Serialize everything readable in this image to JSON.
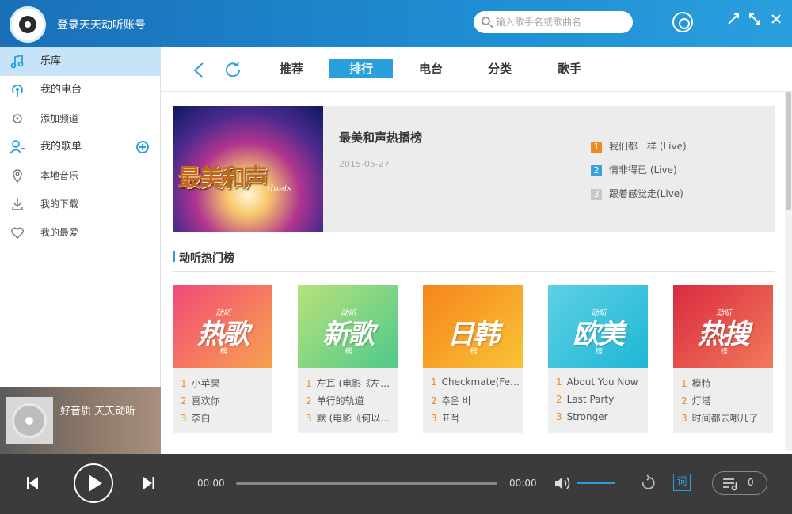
{
  "header": {
    "login_text": "登录天天动听账号",
    "search_placeholder": "输入歌手名或歌曲名"
  },
  "sidebar": {
    "items": [
      {
        "label": "乐库",
        "icon": "music-note-icon",
        "active": true
      },
      {
        "label": "我的电台",
        "icon": "radio-icon"
      },
      {
        "label": "添加频道",
        "icon": "target-icon",
        "sub": true
      },
      {
        "label": "我的歌单",
        "icon": "user-icon"
      },
      {
        "label": "本地音乐",
        "icon": "location-icon",
        "sub": true
      },
      {
        "label": "我的下载",
        "icon": "download-icon",
        "sub": true
      },
      {
        "label": "我的最爱",
        "icon": "heart-icon",
        "sub": true
      }
    ]
  },
  "mini_player": {
    "text": "好音质 天天动听"
  },
  "tabs": [
    "推荐",
    "排行",
    "电台",
    "分类",
    "歌手"
  ],
  "active_tab": "排行",
  "banner": {
    "art_text": "最美和声",
    "art_sub": "duets",
    "title": "最美和声热播榜",
    "date": "2015-05-27",
    "tracks": [
      {
        "num": "1",
        "name": "我们都一样 (Live)"
      },
      {
        "num": "2",
        "name": "情非得已 (Live)"
      },
      {
        "num": "3",
        "name": "跟着感觉走(Live)"
      }
    ]
  },
  "section": {
    "title": "动听热门榜"
  },
  "charts": [
    {
      "brand": "动听",
      "art_text": "热歌",
      "sub": "榜",
      "gradient": [
        "#f24a7a",
        "#f7a34b"
      ],
      "songs": [
        "小苹果",
        "喜欢你",
        "李白"
      ]
    },
    {
      "brand": "动听",
      "art_text": "新歌",
      "sub": "榜",
      "gradient": [
        "#4fc98a",
        "#b7e27a"
      ],
      "songs": [
        "左耳 (电影《左耳》主题曲)",
        "单行的轨道",
        "默 (电影《何以笙箫默》主题曲)"
      ]
    },
    {
      "brand": "",
      "art_text": "日韩",
      "sub": "榜",
      "gradient": [
        "#f5851c",
        "#f9c336"
      ],
      "songs": [
        "Checkmate(Feat. Yoo Seung Woo)",
        "추운 비",
        "표적"
      ]
    },
    {
      "brand": "动听",
      "art_text": "欧美",
      "sub": "榜",
      "gradient": [
        "#1db7d6",
        "#5fd0e4"
      ],
      "songs": [
        "About You Now",
        "Last Party",
        "Stronger"
      ]
    },
    {
      "brand": "动听",
      "art_text": "热搜",
      "sub": "榜",
      "gradient": [
        "#d92a3f",
        "#f27a5a"
      ],
      "songs": [
        "模特",
        "灯塔",
        "时间都去哪儿了"
      ]
    }
  ],
  "player": {
    "time_current": "00:00",
    "time_total": "00:00",
    "lyric_label": "词",
    "playlist_count": "0"
  },
  "colors": {
    "accent": "#2a9fde",
    "rank_1": "#f08a1c",
    "rank_2": "#3aa0e0",
    "rank_3": "#c8c8c8"
  }
}
